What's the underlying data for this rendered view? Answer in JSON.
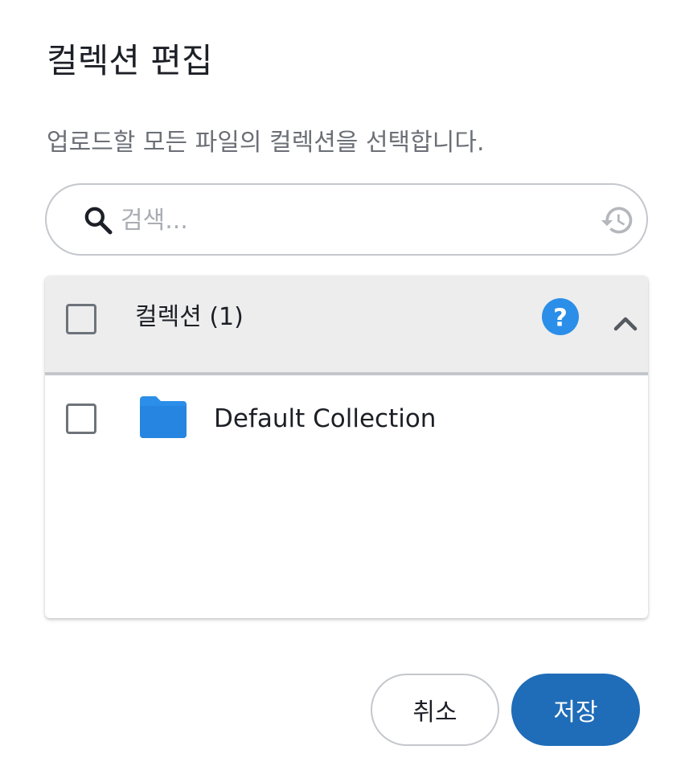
{
  "dialog": {
    "title": "컬렉션 편집",
    "subtitle": "업로드할 모든 파일의 컬렉션을 선택합니다."
  },
  "search": {
    "placeholder": "검색...",
    "value": "",
    "icon": "search-icon",
    "history_icon": "history-icon"
  },
  "collections": {
    "header_label": "컬렉션 (1)",
    "header_checked": false,
    "help_icon": "help-icon",
    "collapse_icon": "chevron-up-icon",
    "items": [
      {
        "label": "Default Collection",
        "checked": false,
        "icon": "folder-icon"
      }
    ]
  },
  "actions": {
    "cancel_label": "취소",
    "save_label": "저장"
  },
  "colors": {
    "accent": "#1f6cb8",
    "help": "#2b8ee8",
    "folder": "#2b8ee8",
    "header_bg": "#ededed"
  }
}
